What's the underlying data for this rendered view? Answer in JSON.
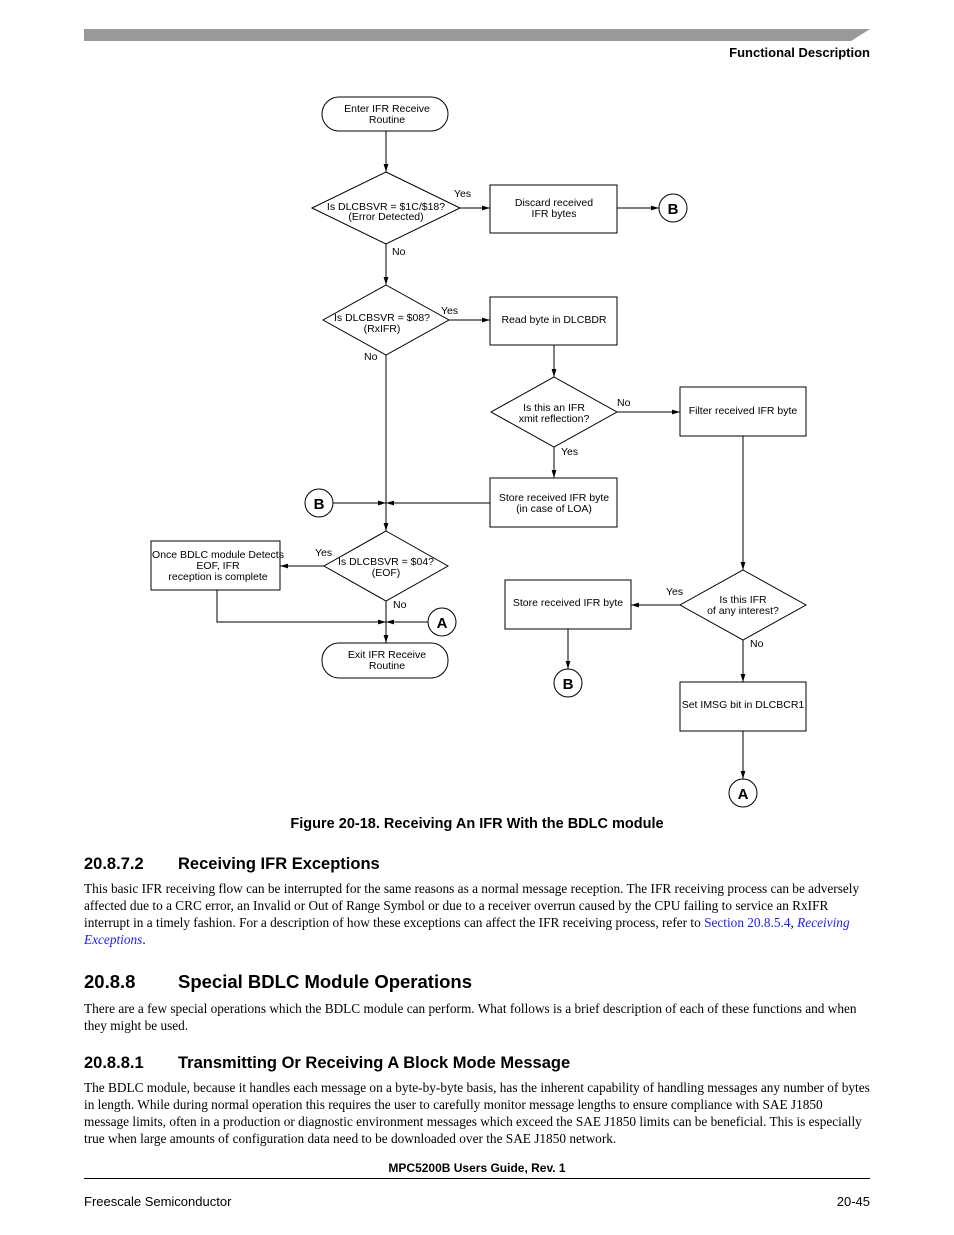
{
  "header": {
    "section_title": "Functional Description"
  },
  "flowchart": {
    "start": [
      "Enter IFR Receive",
      "Routine"
    ],
    "decision_error": [
      "Is DLCBSVR = $1C/$18?",
      "(Error Detected)"
    ],
    "discard": [
      "Discard received",
      "IFR bytes"
    ],
    "decision_rxifr": [
      "Is DLCBSVR = $08?",
      "(RxIFR)"
    ],
    "read_byte": [
      "Read byte in DLCBDR"
    ],
    "decision_reflection": [
      "Is this an IFR",
      "xmit reflection?"
    ],
    "filter": [
      "Filter received IFR byte"
    ],
    "store_loa": [
      "Store received IFR byte",
      "(in case of LOA)"
    ],
    "decision_eof": [
      "Is DLCBSVR = $04?",
      "(EOF)"
    ],
    "eof_complete": [
      "Once BDLC module Detects",
      "EOF, IFR",
      "reception is complete"
    ],
    "exit": [
      "Exit IFR Receive",
      "Routine"
    ],
    "decision_interest": [
      "Is this IFR",
      "of any interest?"
    ],
    "store_byte": [
      "Store received IFR byte"
    ],
    "set_imsg": [
      "Set IMSG bit in DLCBCR1"
    ],
    "yes": "Yes",
    "no": "No",
    "connector_a": "A",
    "connector_b": "B"
  },
  "figure": {
    "caption": "Figure 20-18. Receiving An IFR With the BDLC module"
  },
  "sections": [
    {
      "number": "20.8.7.2",
      "title": "Receiving IFR Exceptions",
      "body": "This basic IFR receiving flow can be interrupted for the same reasons as a normal message reception. The IFR receiving process can be adversely affected due to a CRC error, an Invalid or Out of Range Symbol or due to a receiver overrun caused by the CPU failing to service an RxIFR interrupt in a timely fashion. For a description of how these exceptions can affect the IFR receiving process, refer to ",
      "link_text": "Section 20.8.5.4",
      "link_sep": ", ",
      "link_italic": "Receiving Exceptions",
      "tail": "."
    },
    {
      "number": "20.8.8",
      "title": "Special BDLC Module Operations",
      "body": "There are a few special operations which the BDLC module can perform. What follows is a brief description of each of these functions and when they might be used."
    },
    {
      "number": "20.8.8.1",
      "title": "Transmitting Or Receiving A Block Mode Message",
      "body": "The BDLC module, because it handles each message on a byte-by-byte basis, has the inherent capability of handling messages any number of bytes in length. While during normal operation this requires the user to carefully monitor message lengths to ensure compliance with SAE J1850 message limits, often in a production or diagnostic environment messages which exceed the SAE J1850 limits can be beneficial. This is especially true when large amounts of configuration data need to be downloaded over the SAE J1850 network."
    }
  ],
  "footer": {
    "doc_title": "MPC5200B Users Guide, Rev. 1",
    "company": "Freescale Semiconductor",
    "page_number": "20-45"
  }
}
